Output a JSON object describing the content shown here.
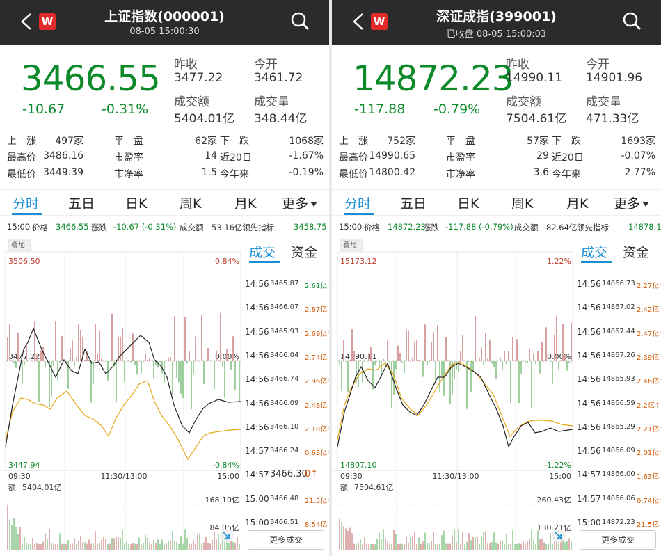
{
  "colors": {
    "green": "#0c8a2a",
    "red": "#c0392b",
    "blue": "#1a8fd6",
    "yellow": "#e6a817"
  },
  "panels": [
    {
      "title": "上证指数(000001)",
      "subtitle": "08-05 15:00:30",
      "price": "3466.55",
      "change": "-10.67",
      "change_pct": "-0.31%",
      "prev_close_label": "昨收",
      "prev_close": "3477.22",
      "open_label": "今开",
      "open": "3461.72",
      "amount_label": "成交额",
      "amount": "5404.01亿",
      "volume_label": "成交量",
      "volume": "348.44亿",
      "stats": [
        [
          "上　涨",
          "497家",
          "平　盘",
          "62家",
          "下　跌",
          "1068家"
        ],
        [
          "最高价",
          "3486.16",
          "市盈率",
          "14",
          "近20日",
          "-1.67%"
        ],
        [
          "最低价",
          "3449.39",
          "市净率",
          "1.5",
          "今年来",
          "-0.19%"
        ]
      ],
      "tabs": [
        "分时",
        "五日",
        "日K",
        "周K",
        "月K",
        "更多"
      ],
      "info": {
        "time": "15:00",
        "price_label": "价格",
        "price": "3466.55",
        "chg_label": "涨跌",
        "chg": "-10.67 (-0.31%)",
        "amount_label": "成交额",
        "amount": "53.16亿",
        "lead_label": "领先指标",
        "lead": "3458.75"
      },
      "chart": {
        "overlay_label": "叠加",
        "high": "3506.50",
        "high_pct": "0.84%",
        "mid": "3477.22",
        "mid_pct": "0.00%",
        "low": "3447.94",
        "low_pct": "-0.84%",
        "t_start": "09:30",
        "t_mid": "11:30/13:00",
        "t_end": "15:00",
        "vol_label": "额",
        "vol_amount": "5404.01亿",
        "vol_max": "168.10亿",
        "vol_half": "84.05亿"
      },
      "side_tabs": [
        "成交",
        "资金"
      ],
      "trades": [
        {
          "t": "14:56",
          "p": "3465.87",
          "v": "2.61亿↓",
          "dir": "dn"
        },
        {
          "t": "14:56",
          "p": "3466.07",
          "v": "2.87亿↑",
          "dir": "up"
        },
        {
          "t": "14:56",
          "p": "3465.93",
          "v": "2.69亿↑",
          "dir": "up"
        },
        {
          "t": "14:56",
          "p": "3466.04",
          "v": "2.74亿↑",
          "dir": "up"
        },
        {
          "t": "14:56",
          "p": "3466.74",
          "v": "2.96亿↑",
          "dir": "up"
        },
        {
          "t": "14:56",
          "p": "3466.09",
          "v": "2.48亿↑",
          "dir": "up"
        },
        {
          "t": "14:56",
          "p": "3466.10",
          "v": "2.18亿↑",
          "dir": "up"
        },
        {
          "t": "14:57",
          "p": "3466.24",
          "v": "0.63亿↑",
          "dir": "up"
        },
        {
          "t": "14:57",
          "p": "3466.30",
          "v": "0↑",
          "dir": "up",
          "big": true
        },
        {
          "t": "15:00",
          "p": "3466.48",
          "v": "21.5亿↑",
          "dir": "up"
        },
        {
          "t": "15:00",
          "p": "3466.51",
          "v": "8.54亿↑",
          "dir": "up"
        }
      ],
      "more_trades": "更多成交"
    },
    {
      "title": "深证成指(399001)",
      "subtitle": "已收盘 08-05 15:00:03",
      "price": "14872.23",
      "change": "-117.88",
      "change_pct": "-0.79%",
      "prev_close_label": "昨收",
      "prev_close": "14990.11",
      "open_label": "今开",
      "open": "14901.96",
      "amount_label": "成交额",
      "amount": "7504.61亿",
      "volume_label": "成交量",
      "volume": "471.33亿",
      "stats": [
        [
          "上　涨",
          "752家",
          "平　盘",
          "57家",
          "下　跌",
          "1693家"
        ],
        [
          "最高价",
          "14990.65",
          "市盈率",
          "29",
          "近20日",
          "-0.07%"
        ],
        [
          "最低价",
          "14800.42",
          "市净率",
          "3.6",
          "今年来",
          "2.77%"
        ]
      ],
      "tabs": [
        "分时",
        "五日",
        "日K",
        "周K",
        "月K",
        "更多"
      ],
      "info": {
        "time": "15:00",
        "price_label": "价格",
        "price": "14872.23",
        "chg_label": "涨跌",
        "chg": "-117.88 (-0.79%)",
        "amount_label": "成交额",
        "amount": "82.64亿",
        "lead_label": "领先指标",
        "lead": "14878.10"
      },
      "chart": {
        "overlay_label": "叠加",
        "high": "15173.12",
        "high_pct": "1.22%",
        "mid": "14990.11",
        "mid_pct": "0.00%",
        "low": "14807.10",
        "low_pct": "-1.22%",
        "t_start": "09:30",
        "t_mid": "11:30/13:00",
        "t_end": "15:00",
        "vol_label": "额",
        "vol_amount": "7504.61亿",
        "vol_max": "260.43亿",
        "vol_half": "130.21亿"
      },
      "side_tabs": [
        "成交",
        "资金"
      ],
      "trades": [
        {
          "t": "14:56",
          "p": "14866.73",
          "v": "2.27亿↑",
          "dir": "up"
        },
        {
          "t": "14:56",
          "p": "14867.02",
          "v": "2.42亿↑",
          "dir": "up"
        },
        {
          "t": "14:56",
          "p": "14867.44",
          "v": "2.47亿↑",
          "dir": "up"
        },
        {
          "t": "14:56",
          "p": "14867.26",
          "v": "2.39亿↑",
          "dir": "up"
        },
        {
          "t": "14:56",
          "p": "14865.93",
          "v": "2.46亿↑",
          "dir": "up"
        },
        {
          "t": "14:56",
          "p": "14866.59",
          "v": "2.2亿↑",
          "dir": "up"
        },
        {
          "t": "14:56",
          "p": "14865.29",
          "v": "2.21亿↑",
          "dir": "up"
        },
        {
          "t": "14:56",
          "p": "14866.09",
          "v": "2.01亿↑",
          "dir": "up"
        },
        {
          "t": "14:57",
          "p": "14866.00",
          "v": "1.63亿↑",
          "dir": "up"
        },
        {
          "t": "14:57",
          "p": "14866.06",
          "v": "0.74亿↑",
          "dir": "up"
        },
        {
          "t": "15:00",
          "p": "14872.23",
          "v": "21.5亿↑",
          "dir": "up"
        }
      ],
      "more_trades": "更多成交"
    }
  ]
}
